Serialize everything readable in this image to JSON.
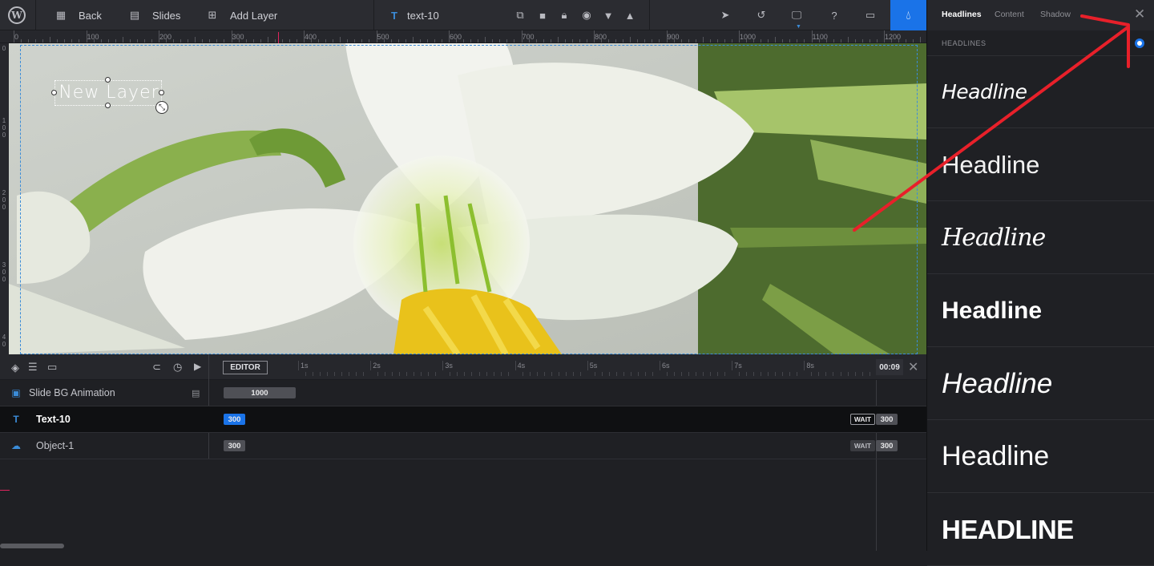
{
  "toolbar": {
    "back_label": "Back",
    "slides_label": "Slides",
    "add_layer_label": "Add Layer",
    "layer_name": "text-10"
  },
  "ruler": {
    "top_labels": [
      "0",
      "100",
      "200",
      "300",
      "400",
      "500",
      "600",
      "700",
      "800",
      "900",
      "1000",
      "1100",
      "1200"
    ],
    "left_labels": [
      "0",
      "1\n0\n0",
      "2\n0\n0",
      "3\n0\n0",
      "4\n0"
    ]
  },
  "canvas": {
    "layer_text": "New Layer"
  },
  "timeline": {
    "editor_label": "EDITOR",
    "seconds": [
      "1s",
      "2s",
      "3s",
      "4s",
      "5s",
      "6s",
      "7s",
      "8s"
    ],
    "end_time": "00:09",
    "rows": [
      {
        "label": "Slide BG Animation",
        "start_value": "1000"
      },
      {
        "label": "Text-10",
        "start_value": "300",
        "wait_label": "WAIT",
        "end_value": "300"
      },
      {
        "label": "Object-1",
        "start_value": "300",
        "wait_label": "WAIT",
        "end_value": "300"
      }
    ]
  },
  "right_panel": {
    "tabs": [
      "Headlines",
      "Content",
      "Shadow"
    ],
    "active_tab": "Headlines",
    "section_label": "HEADLINES",
    "presets": [
      "Headline",
      "Headline",
      "Headline",
      "Headline",
      "Headline",
      "Headline",
      "HEADLINE"
    ]
  },
  "colors": {
    "accent": "#1a73e8",
    "annotation_arrow": "#e8202a",
    "selection_guide": "#3b8cd8"
  }
}
